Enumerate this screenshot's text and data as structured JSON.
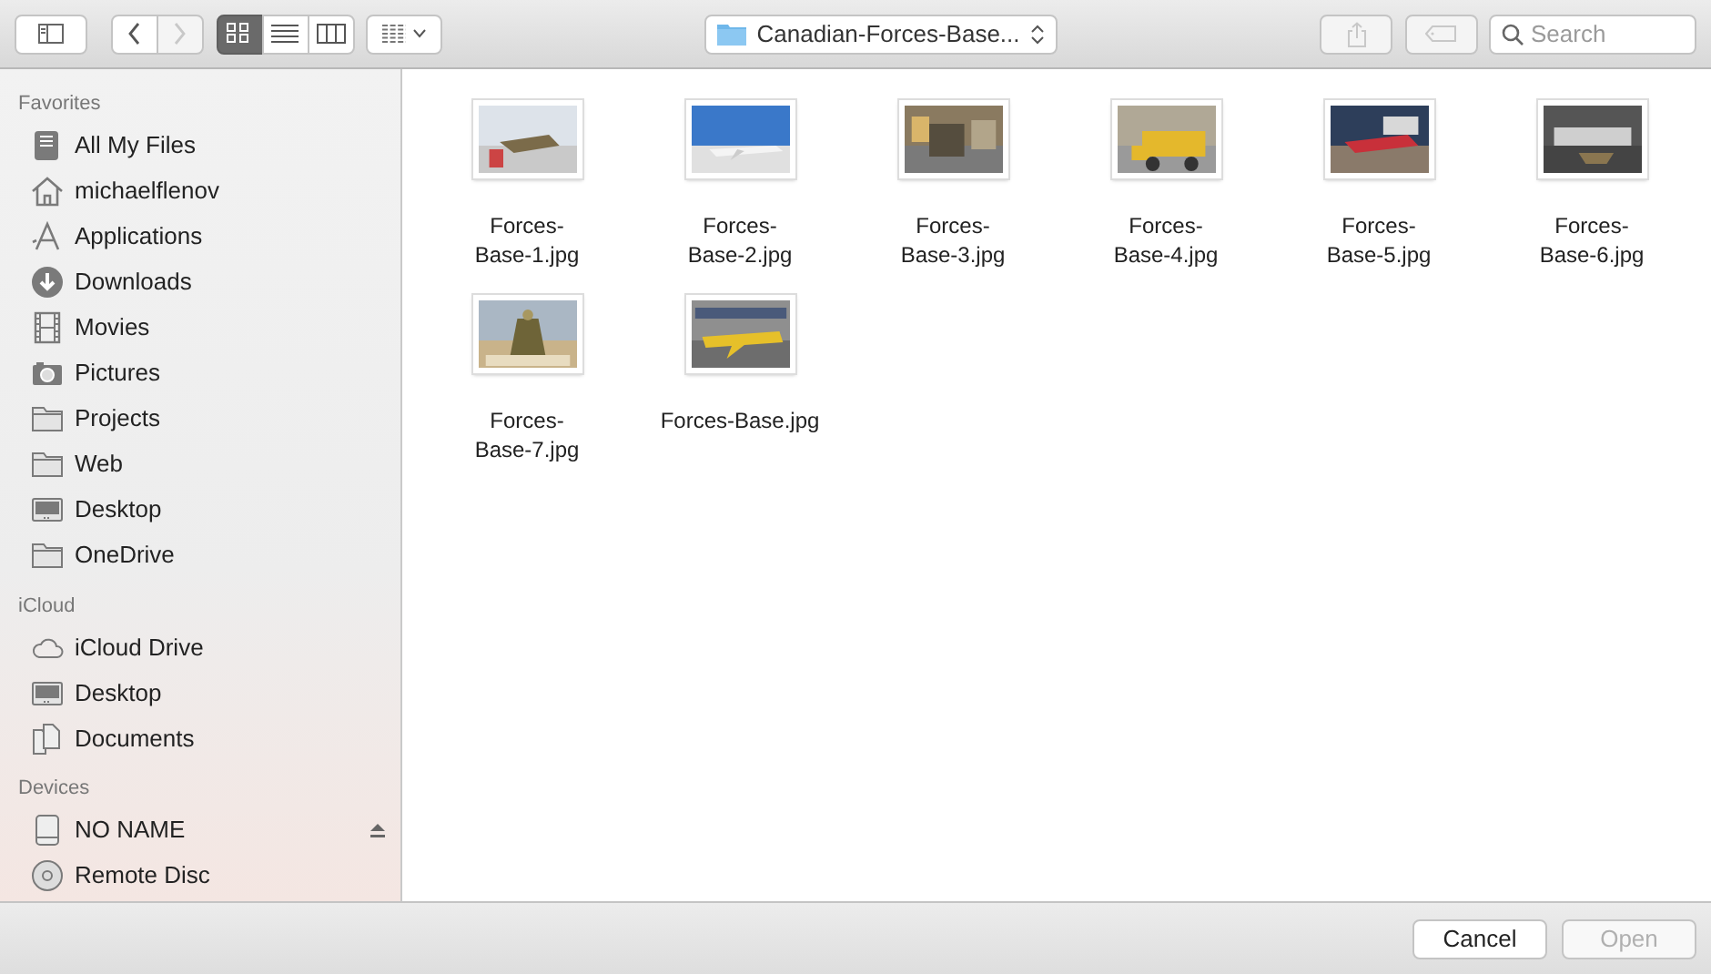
{
  "toolbar": {
    "back": {
      "disabled": false
    },
    "forward": {
      "disabled": true
    },
    "view_modes": [
      {
        "kind": "icons",
        "selected": true
      },
      {
        "kind": "list",
        "selected": false
      },
      {
        "kind": "columns",
        "selected": false
      }
    ],
    "location": {
      "label": "Canadian-Forces-Base..."
    },
    "share": {
      "disabled": true
    },
    "tags": {
      "disabled": true
    },
    "search": {
      "placeholder": "Search"
    }
  },
  "sidebar": {
    "sections": [
      {
        "title": "Favorites",
        "items": [
          {
            "label": "All My Files",
            "kind": "files"
          },
          {
            "label": "michaelflenov",
            "kind": "home"
          },
          {
            "label": "Applications",
            "kind": "apps"
          },
          {
            "label": "Downloads",
            "kind": "download"
          },
          {
            "label": "Movies",
            "kind": "film"
          },
          {
            "label": "Pictures",
            "kind": "camera"
          },
          {
            "label": "Projects",
            "kind": "folder"
          },
          {
            "label": "Web",
            "kind": "folder"
          },
          {
            "label": "Desktop",
            "kind": "desktop"
          },
          {
            "label": "OneDrive",
            "kind": "folder"
          }
        ]
      },
      {
        "title": "iCloud",
        "items": [
          {
            "label": "iCloud Drive",
            "kind": "cloud"
          },
          {
            "label": "Desktop",
            "kind": "desktop"
          },
          {
            "label": "Documents",
            "kind": "documents"
          }
        ]
      },
      {
        "title": "Devices",
        "items": [
          {
            "label": "NO NAME",
            "kind": "drive",
            "ejectable": true
          },
          {
            "label": "Remote Disc",
            "kind": "disc"
          }
        ]
      }
    ]
  },
  "files": [
    {
      "lines": [
        "Forces-",
        "Base-1.jpg"
      ]
    },
    {
      "lines": [
        "Forces-",
        "Base-2.jpg"
      ]
    },
    {
      "lines": [
        "Forces-",
        "Base-3.jpg"
      ]
    },
    {
      "lines": [
        "Forces-",
        "Base-4.jpg"
      ]
    },
    {
      "lines": [
        "Forces-",
        "Base-5.jpg"
      ]
    },
    {
      "lines": [
        "Forces-",
        "Base-6.jpg"
      ]
    },
    {
      "lines": [
        "Forces-",
        "Base-7.jpg"
      ]
    },
    {
      "lines": [
        "Forces-Base.jpg"
      ]
    }
  ],
  "buttons": [
    {
      "label": "Cancel",
      "disabled": false
    },
    {
      "label": "Open",
      "disabled": true
    }
  ]
}
